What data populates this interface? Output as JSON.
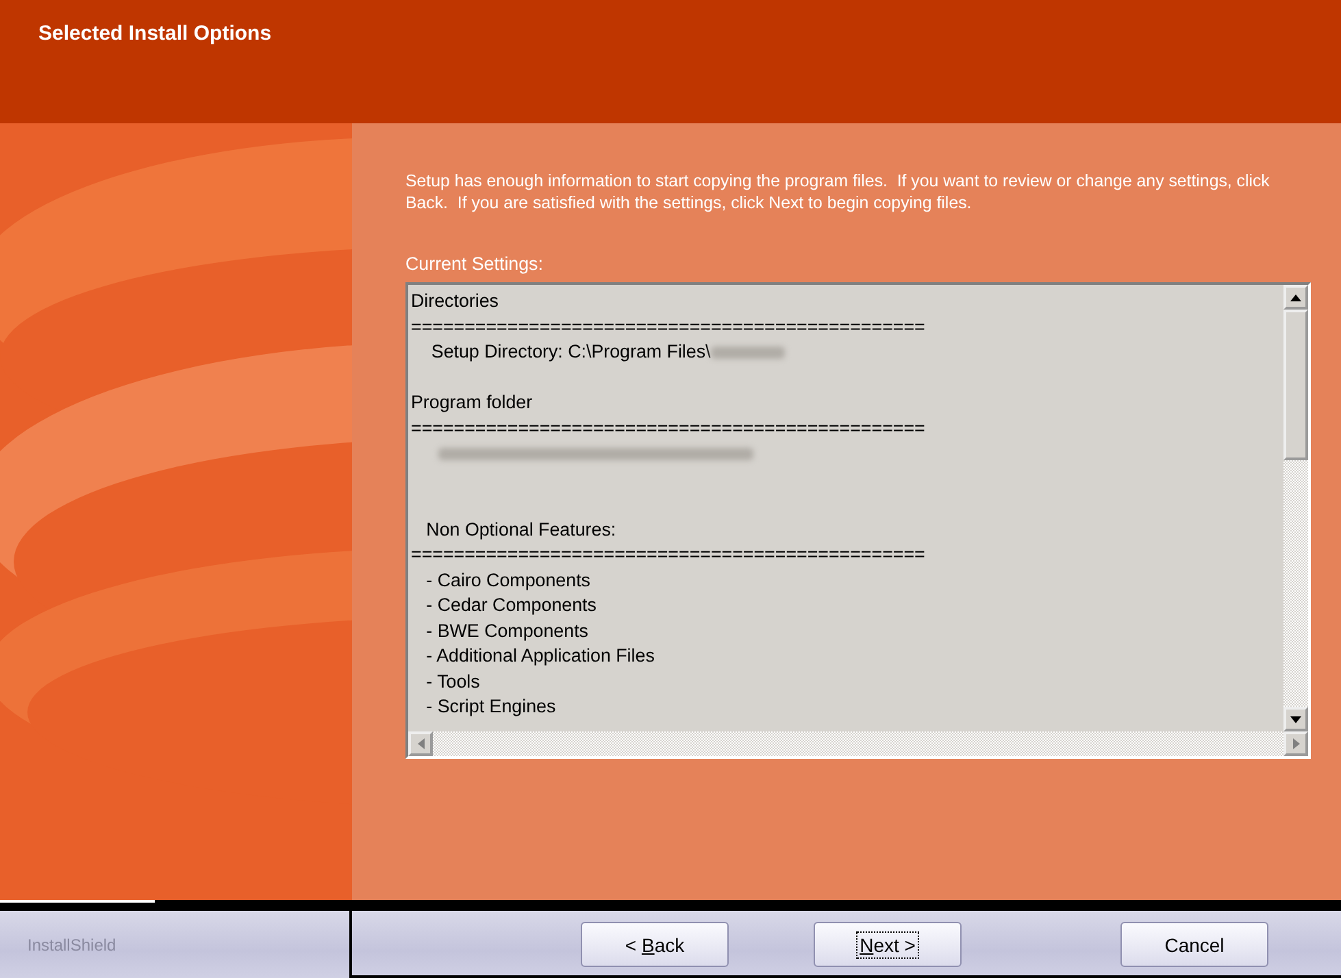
{
  "window": {
    "title": "Selected Install Options"
  },
  "intro": "Setup has enough information to start copying the program files.  If you want to review or change any settings, click Back.  If you are satisfied with the settings, click Next to begin copying files.",
  "settings_label": "Current Settings:",
  "settings_lines": [
    {
      "kind": "text",
      "text": "Directories"
    },
    {
      "kind": "text",
      "text": "================================================"
    },
    {
      "kind": "text",
      "text": "    Setup Directory: C:\\Program Files\\",
      "redacted": true
    },
    {
      "kind": "blank"
    },
    {
      "kind": "text",
      "text": "Program folder"
    },
    {
      "kind": "text",
      "text": "================================================"
    },
    {
      "kind": "redacted"
    },
    {
      "kind": "blank"
    },
    {
      "kind": "blank"
    },
    {
      "kind": "text",
      "text": "   Non Optional Features:"
    },
    {
      "kind": "text",
      "text": "================================================"
    },
    {
      "kind": "text",
      "text": "   - Cairo Components"
    },
    {
      "kind": "text",
      "text": "   - Cedar Components"
    },
    {
      "kind": "text",
      "text": "   - BWE Components"
    },
    {
      "kind": "text",
      "text": "   - Additional Application Files"
    },
    {
      "kind": "text",
      "text": "   - Tools"
    },
    {
      "kind": "text",
      "text": "   - Script Engines"
    }
  ],
  "brand": "InstallShield",
  "buttons": [
    {
      "before": "< ",
      "mnemonic": "B",
      "after": "ack",
      "focused": false
    },
    {
      "mnemonic": "N",
      "after": "ext >",
      "focused": true
    },
    {
      "before": "Cancel",
      "focused": false
    }
  ]
}
